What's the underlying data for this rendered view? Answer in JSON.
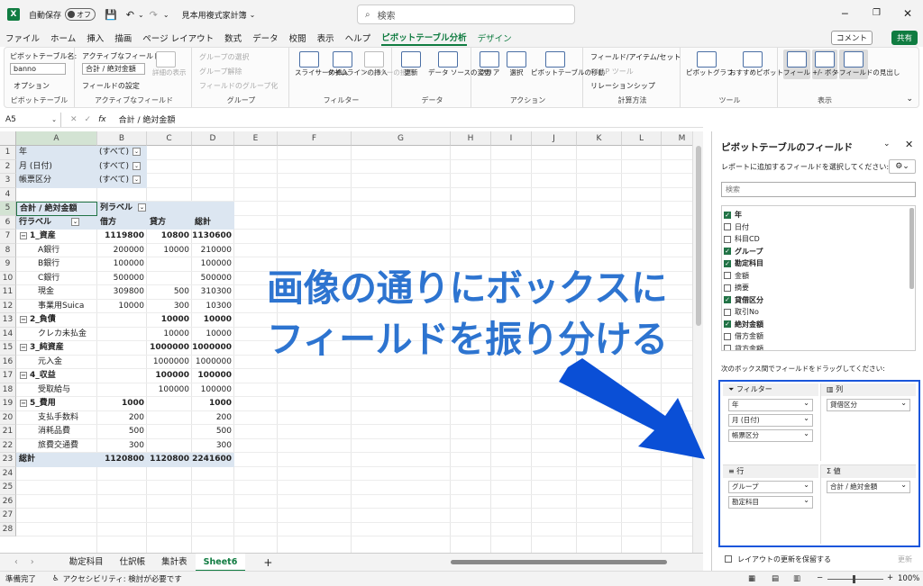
{
  "title_bar": {
    "logo": "X",
    "autosave": "自動保存",
    "toggle": "オフ",
    "filename": "見本用複式家計簿",
    "search_placeholder": "検索"
  },
  "menu": [
    "ファイル",
    "ホーム",
    "挿入",
    "描画",
    "ページ レイアウト",
    "数式",
    "データ",
    "校閲",
    "表示",
    "ヘルプ",
    "ピボットテーブル分析",
    "デザイン"
  ],
  "menu_active": "ピボットテーブル分析",
  "menu_context": "デザイン",
  "comment_btn": "コメント",
  "share_btn": "共有",
  "ribbon": {
    "pt_name_label": "ピボットテーブル名:",
    "pt_name": "banno",
    "options": "オプション",
    "grp_pivot": "ピボットテーブル",
    "active_field_label": "アクティブなフィールド:",
    "active_field": "合計 / 絶対金額",
    "field_settings": "フィールドの設定",
    "drill": "詳細の表示",
    "grp_active": "アクティブなフィールド",
    "group_selection": "グループの選択",
    "ungroup": "グループ解除",
    "group_field": "フィールドのグループ化",
    "grp_group": "グループ",
    "slicer": "スライサーの挿入",
    "timeline": "タイムラインの挿入",
    "filter_conn": "フィルターの接続",
    "grp_filter": "フィルター",
    "refresh": "更新",
    "change_source": "データ ソースの変更",
    "grp_data": "データ",
    "clear": "クリア",
    "select": "選択",
    "move_pt": "ピボットテーブルの移動",
    "grp_action": "アクション",
    "fields_items": "フィールド/アイテム/セット",
    "olap": "OLAP ツール",
    "relations": "リレーションシップ",
    "grp_calc": "計算方法",
    "pivotchart": "ピボットグラフ",
    "recommended": "おすすめピボットテーブル",
    "grp_tools": "ツール",
    "field_list": "フィールド リスト",
    "plusminus": "+/- ボタン",
    "field_headers": "フィールドの見出し",
    "grp_show": "表示"
  },
  "formula_bar": {
    "cell": "A5",
    "fx": "fx",
    "value": "合計 / 絶対金額"
  },
  "columns": [
    "A",
    "B",
    "C",
    "D",
    "E",
    "F",
    "G",
    "H",
    "I",
    "J",
    "K",
    "L",
    "M"
  ],
  "rows": [
    "1",
    "2",
    "3",
    "4",
    "5",
    "6",
    "7",
    "8",
    "9",
    "10",
    "11",
    "12",
    "13",
    "14",
    "15",
    "16",
    "17",
    "18",
    "19",
    "20",
    "21",
    "22",
    "23",
    "24",
    "25",
    "26",
    "27",
    "28"
  ],
  "filters": [
    {
      "name": "年",
      "value": "(すべて)"
    },
    {
      "name": "月 (日付)",
      "value": "(すべて)"
    },
    {
      "name": "帳票区分",
      "value": "(すべて)"
    }
  ],
  "pivot": {
    "sum_label": "合計 / 絶対金額",
    "col_label": "列ラベル",
    "row_label": "行ラベル",
    "debit": "借方",
    "credit": "貸方",
    "total": "総計",
    "lines": [
      {
        "label": "1_資産",
        "d": "1119800",
        "c": "10800",
        "t": "1130600",
        "level": 0
      },
      {
        "label": "A銀行",
        "d": "200000",
        "c": "10000",
        "t": "210000",
        "level": 1
      },
      {
        "label": "B銀行",
        "d": "100000",
        "c": "",
        "t": "100000",
        "level": 1
      },
      {
        "label": "C銀行",
        "d": "500000",
        "c": "",
        "t": "500000",
        "level": 1
      },
      {
        "label": "現金",
        "d": "309800",
        "c": "500",
        "t": "310300",
        "level": 1
      },
      {
        "label": "事業用Suica",
        "d": "10000",
        "c": "300",
        "t": "10300",
        "level": 1
      },
      {
        "label": "2_負債",
        "d": "",
        "c": "10000",
        "t": "10000",
        "level": 0
      },
      {
        "label": "クレカ未払金",
        "d": "",
        "c": "10000",
        "t": "10000",
        "level": 1
      },
      {
        "label": "3_純資産",
        "d": "",
        "c": "1000000",
        "t": "1000000",
        "level": 0
      },
      {
        "label": "元入金",
        "d": "",
        "c": "1000000",
        "t": "1000000",
        "level": 1
      },
      {
        "label": "4_収益",
        "d": "",
        "c": "100000",
        "t": "100000",
        "level": 0
      },
      {
        "label": "受取給与",
        "d": "",
        "c": "100000",
        "t": "100000",
        "level": 1
      },
      {
        "label": "5_費用",
        "d": "1000",
        "c": "",
        "t": "1000",
        "level": 0
      },
      {
        "label": "支払手数料",
        "d": "200",
        "c": "",
        "t": "200",
        "level": 1
      },
      {
        "label": "消耗品費",
        "d": "500",
        "c": "",
        "t": "500",
        "level": 1
      },
      {
        "label": "旅費交通費",
        "d": "300",
        "c": "",
        "t": "300",
        "level": 1
      }
    ],
    "grand": {
      "label": "総計",
      "d": "1120800",
      "c": "1120800",
      "t": "2241600"
    }
  },
  "sheet_tabs": [
    "勘定科目",
    "仕訳帳",
    "集計表",
    "Sheet6"
  ],
  "active_tab": "Sheet6",
  "status": {
    "ready": "準備完了",
    "accessibility": "アクセシビリティ: 検討が必要です",
    "zoom": "100%"
  },
  "panel": {
    "title": "ピボットテーブルのフィールド",
    "subtitle": "レポートに追加するフィールドを選択してください:",
    "search": "検索",
    "fields": [
      {
        "n": "年",
        "c": true
      },
      {
        "n": "日付",
        "c": false
      },
      {
        "n": "科目CD",
        "c": false
      },
      {
        "n": "グループ",
        "c": true
      },
      {
        "n": "勘定科目",
        "c": true
      },
      {
        "n": "金額",
        "c": false
      },
      {
        "n": "摘要",
        "c": false
      },
      {
        "n": "貸借区分",
        "c": true
      },
      {
        "n": "取引No",
        "c": false
      },
      {
        "n": "絶対金額",
        "c": true
      },
      {
        "n": "借方金額",
        "c": false
      },
      {
        "n": "貸方金額",
        "c": false
      }
    ],
    "drag_hint": "次のボックス間でフィールドをドラッグしてください:",
    "filters_label": "フィルター",
    "columns_label": "列",
    "rows_label": "行",
    "values_label": "値",
    "filter_items": [
      "年",
      "月 (日付)",
      "帳票区分"
    ],
    "column_items": [
      "貸借区分"
    ],
    "row_items": [
      "グループ",
      "勘定科目"
    ],
    "value_items": [
      "合計 / 絶対金額"
    ],
    "defer": "レイアウトの更新を保留する",
    "update": "更新"
  },
  "overlay_text": "画像の通りにボックスにフィールドを振り分ける",
  "colors": {
    "excel_green": "#107c41",
    "overlay_blue": "#2d74d0",
    "arrow_blue": "#0a4fd6"
  }
}
